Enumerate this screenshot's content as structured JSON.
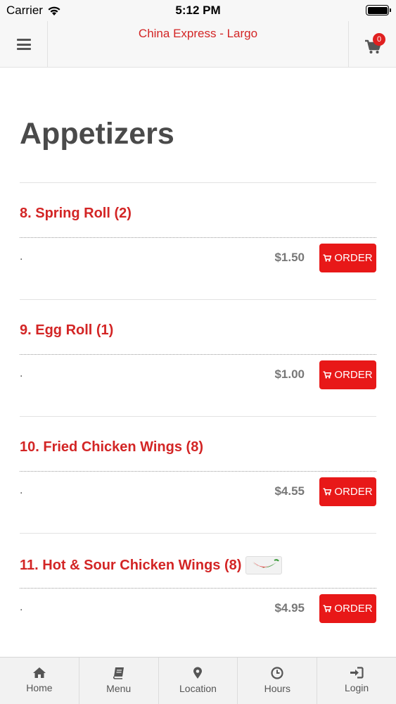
{
  "status_bar": {
    "carrier": "Carrier",
    "time": "5:12 PM"
  },
  "header": {
    "title": "China Express - Largo",
    "cart_count": "0"
  },
  "section": {
    "title": "Appetizers"
  },
  "items": [
    {
      "name": "8. Spring Roll (2)",
      "description": ".",
      "price": "$1.50",
      "order_label": "ORDER",
      "spicy": false
    },
    {
      "name": "9. Egg Roll (1)",
      "description": ".",
      "price": "$1.00",
      "order_label": "ORDER",
      "spicy": false
    },
    {
      "name": "10. Fried Chicken Wings (8)",
      "description": ".",
      "price": "$4.55",
      "order_label": "ORDER",
      "spicy": false
    },
    {
      "name": "11. Hot & Sour Chicken Wings (8)",
      "description": ".",
      "price": "$4.95",
      "order_label": "ORDER",
      "spicy": true
    }
  ],
  "tab_bar": [
    {
      "label": "Home",
      "icon": "home-icon"
    },
    {
      "label": "Menu",
      "icon": "book-icon"
    },
    {
      "label": "Location",
      "icon": "map-pin-icon"
    },
    {
      "label": "Hours",
      "icon": "clock-icon"
    },
    {
      "label": "Login",
      "icon": "sign-in-icon"
    }
  ],
  "colors": {
    "accent": "#d32525",
    "order_button": "#e81818"
  }
}
